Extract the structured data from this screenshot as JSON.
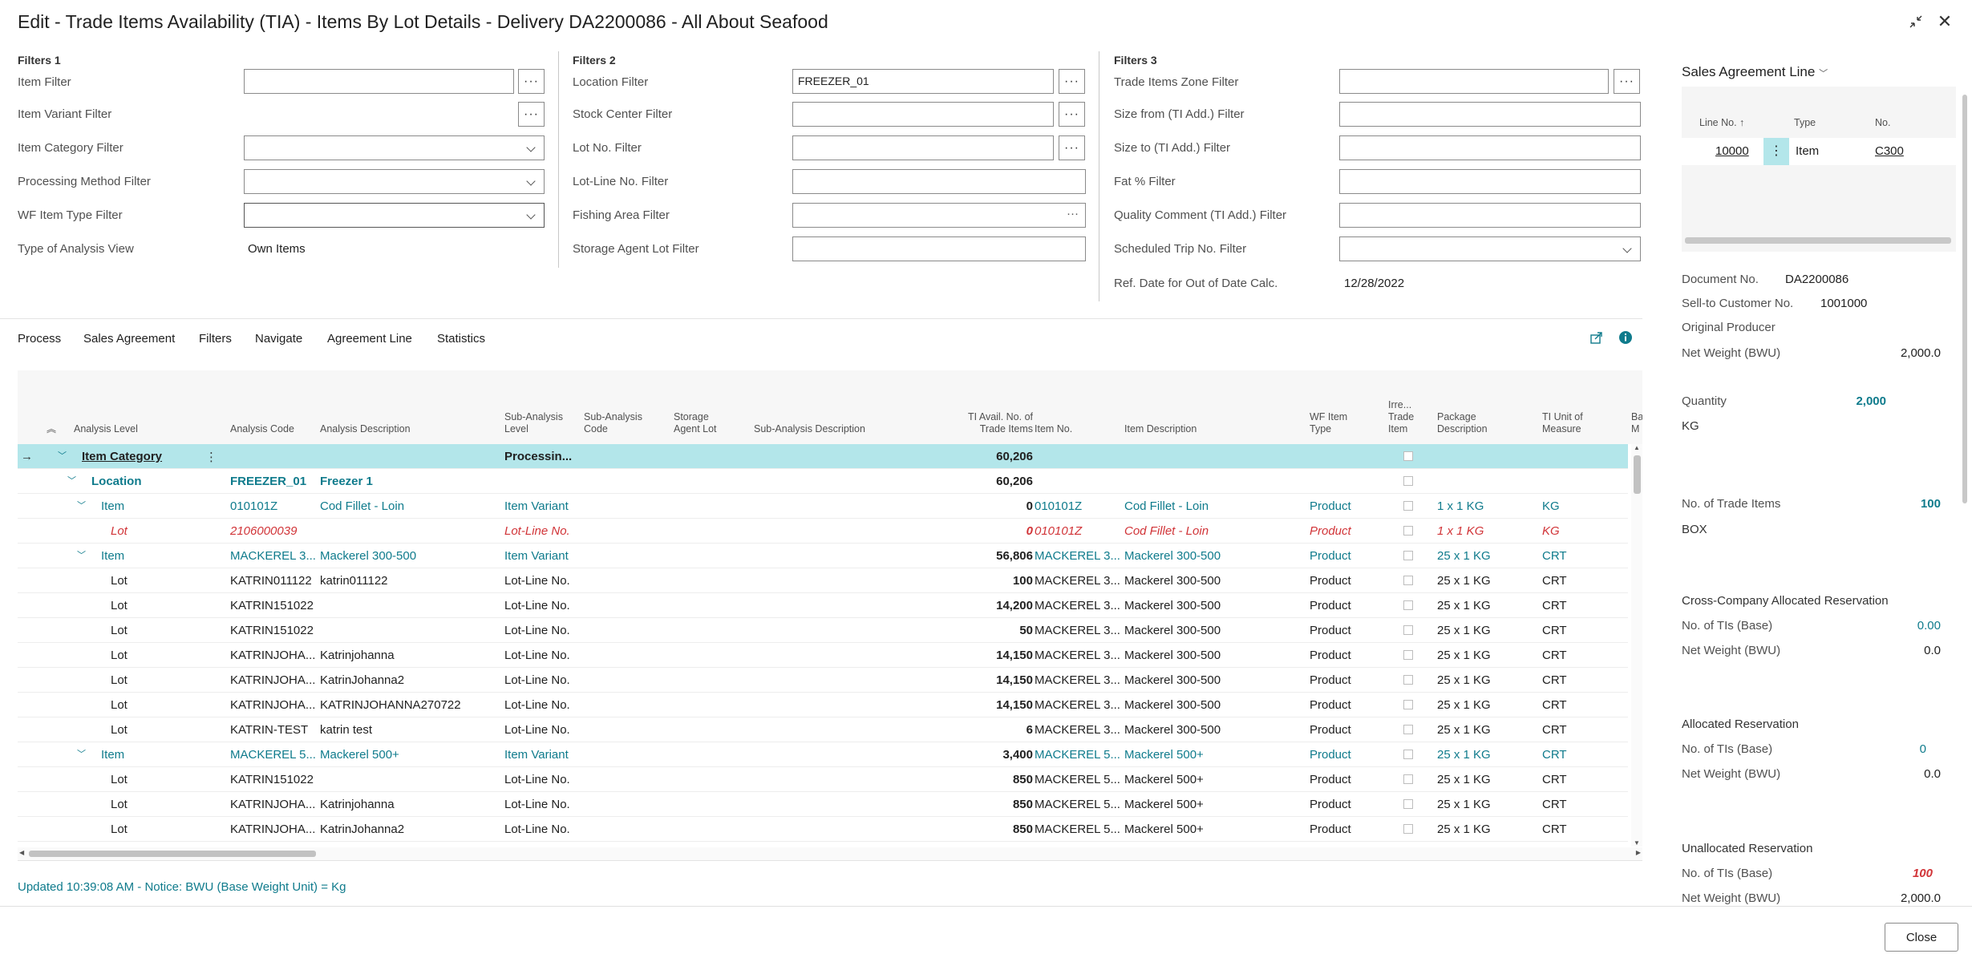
{
  "window": {
    "title": "Edit - Trade Items Availability (TIA) - Items By Lot Details - Delivery DA2200086 - All About Seafood",
    "collapse_icon": "↙↗",
    "close_icon": "✕"
  },
  "filters1": {
    "title": "Filters 1",
    "item_filter": {
      "label": "Item Filter",
      "value": ""
    },
    "item_variant_filter": {
      "label": "Item Variant Filter"
    },
    "item_category_filter": {
      "label": "Item Category Filter",
      "value": ""
    },
    "processing_method_filter": {
      "label": "Processing Method Filter",
      "value": ""
    },
    "wf_item_type_filter": {
      "label": "WF Item Type Filter",
      "value": ""
    },
    "type_of_analysis_view": {
      "label": "Type of Analysis View",
      "value": "Own Items"
    }
  },
  "filters2": {
    "title": "Filters 2",
    "location_filter": {
      "label": "Location Filter",
      "value": "FREEZER_01"
    },
    "stock_center_filter": {
      "label": "Stock Center Filter",
      "value": ""
    },
    "lot_no_filter": {
      "label": "Lot No. Filter",
      "value": ""
    },
    "lot_line_no_filter": {
      "label": "Lot-Line No. Filter",
      "value": ""
    },
    "fishing_area_filter": {
      "label": "Fishing Area Filter",
      "value": ""
    },
    "storage_agent_lot_filter": {
      "label": "Storage Agent Lot Filter",
      "value": ""
    }
  },
  "filters3": {
    "title": "Filters 3",
    "trade_items_zone_filter": {
      "label": "Trade Items Zone Filter",
      "value": ""
    },
    "size_from_filter": {
      "label": "Size from (TI Add.) Filter",
      "value": ""
    },
    "size_to_filter": {
      "label": "Size to (TI Add.) Filter",
      "value": ""
    },
    "fat_filter": {
      "label": "Fat % Filter",
      "value": ""
    },
    "quality_comment_filter": {
      "label": "Quality Comment (TI Add.) Filter",
      "value": ""
    },
    "scheduled_trip_filter": {
      "label": "Scheduled Trip No. Filter",
      "value": ""
    },
    "ref_date": {
      "label": "Ref. Date for Out of Date Calc.",
      "value": "12/28/2022"
    }
  },
  "menu": {
    "items": [
      "Process",
      "Sales Agreement",
      "Filters",
      "Navigate",
      "Agreement Line",
      "Statistics"
    ],
    "share_icon": "share-icon",
    "info_icon": "info-icon"
  },
  "grid": {
    "headers": {
      "analysis_level": "Analysis Level",
      "analysis_code": "Analysis Code",
      "analysis_description": "Analysis Description",
      "sub_analysis_level": [
        "Sub-Analysis",
        "Level"
      ],
      "sub_analysis_code": [
        "Sub-Analysis",
        "Code"
      ],
      "storage_agent_lot": [
        "Storage",
        "Agent Lot"
      ],
      "sub_analysis_description": "Sub-Analysis Description",
      "ti_avail": [
        "TI Avail. No. of",
        "Trade Items"
      ],
      "item_no": "Item No.",
      "item_description": "Item Description",
      "wf_item_type": [
        "WF Item",
        "Type"
      ],
      "irre_trade_item": [
        "Irre...",
        "Trade",
        "Item"
      ],
      "package_description": [
        "Package",
        "Description"
      ],
      "ti_unit_of_measure": [
        "TI Unit of",
        "Measure"
      ],
      "truncated": [
        "Ba",
        "M"
      ]
    },
    "rows": [
      {
        "style": "selected",
        "indent": 0,
        "level": "Item Category",
        "code": "",
        "desc": "",
        "sub_level": "Processin...",
        "avail": "60,206",
        "item_no": "",
        "item_desc": "",
        "wf_type": "",
        "pkg": "",
        "uom": ""
      },
      {
        "style": "location",
        "indent": 1,
        "level": "Location",
        "code": "FREEZER_01",
        "desc": "Freezer 1",
        "sub_level": "",
        "avail": "60,206",
        "item_no": "",
        "item_desc": "",
        "wf_type": "",
        "pkg": "",
        "uom": ""
      },
      {
        "style": "item",
        "indent": 2,
        "level": "Item",
        "code": "010101Z",
        "desc": "Cod Fillet - Loin",
        "sub_level": "Item Variant",
        "avail": "0",
        "item_no": "010101Z",
        "item_desc": "Cod Fillet - Loin",
        "wf_type": "Product",
        "pkg": "1 x 1 KG",
        "uom": "KG"
      },
      {
        "style": "red",
        "indent": 3,
        "level": "Lot",
        "code": "2106000039",
        "desc": "",
        "sub_level": "Lot-Line No.",
        "avail": "0",
        "item_no": "010101Z",
        "item_desc": "Cod Fillet - Loin",
        "wf_type": "Product",
        "pkg": "1 x 1 KG",
        "uom": "KG"
      },
      {
        "style": "item",
        "indent": 2,
        "level": "Item",
        "code": "MACKEREL 3...",
        "desc": "Mackerel 300-500",
        "sub_level": "Item Variant",
        "avail": "56,806",
        "item_no": "MACKEREL 3...",
        "item_desc": "Mackerel 300-500",
        "wf_type": "Product",
        "pkg": "25 x 1 KG",
        "uom": "CRT"
      },
      {
        "style": "lot",
        "indent": 3,
        "level": "Lot",
        "code": "KATRIN011122",
        "desc": "katrin011122",
        "sub_level": "Lot-Line No.",
        "avail": "100",
        "item_no": "MACKEREL 3...",
        "item_desc": "Mackerel 300-500",
        "wf_type": "Product",
        "pkg": "25 x 1 KG",
        "uom": "CRT"
      },
      {
        "style": "lot",
        "indent": 3,
        "level": "Lot",
        "code": "KATRIN151022",
        "desc": "",
        "sub_level": "Lot-Line No.",
        "avail": "14,200",
        "item_no": "MACKEREL 3...",
        "item_desc": "Mackerel 300-500",
        "wf_type": "Product",
        "pkg": "25 x 1 KG",
        "uom": "CRT"
      },
      {
        "style": "lot",
        "indent": 3,
        "level": "Lot",
        "code": "KATRIN151022",
        "desc": "",
        "sub_level": "Lot-Line No.",
        "avail": "50",
        "item_no": "MACKEREL 3...",
        "item_desc": "Mackerel 300-500",
        "wf_type": "Product",
        "pkg": "25 x 1 KG",
        "uom": "CRT"
      },
      {
        "style": "lot",
        "indent": 3,
        "level": "Lot",
        "code": "KATRINJOHA...",
        "desc": "Katrinjohanna",
        "sub_level": "Lot-Line No.",
        "avail": "14,150",
        "item_no": "MACKEREL 3...",
        "item_desc": "Mackerel 300-500",
        "wf_type": "Product",
        "pkg": "25 x 1 KG",
        "uom": "CRT"
      },
      {
        "style": "lot",
        "indent": 3,
        "level": "Lot",
        "code": "KATRINJOHA...",
        "desc": "KatrinJohanna2",
        "sub_level": "Lot-Line No.",
        "avail": "14,150",
        "item_no": "MACKEREL 3...",
        "item_desc": "Mackerel 300-500",
        "wf_type": "Product",
        "pkg": "25 x 1 KG",
        "uom": "CRT"
      },
      {
        "style": "lot",
        "indent": 3,
        "level": "Lot",
        "code": "KATRINJOHA...",
        "desc": "KATRINJOHANNA270722",
        "sub_level": "Lot-Line No.",
        "avail": "14,150",
        "item_no": "MACKEREL 3...",
        "item_desc": "Mackerel 300-500",
        "wf_type": "Product",
        "pkg": "25 x 1 KG",
        "uom": "CRT"
      },
      {
        "style": "lot",
        "indent": 3,
        "level": "Lot",
        "code": "KATRIN-TEST",
        "desc": "katrin test",
        "sub_level": "Lot-Line No.",
        "avail": "6",
        "item_no": "MACKEREL 3...",
        "item_desc": "Mackerel 300-500",
        "wf_type": "Product",
        "pkg": "25 x 1 KG",
        "uom": "CRT"
      },
      {
        "style": "item",
        "indent": 2,
        "level": "Item",
        "code": "MACKEREL 5...",
        "desc": "Mackerel 500+",
        "sub_level": "Item Variant",
        "avail": "3,400",
        "item_no": "MACKEREL 5...",
        "item_desc": "Mackerel 500+",
        "wf_type": "Product",
        "pkg": "25 x 1 KG",
        "uom": "CRT"
      },
      {
        "style": "lot",
        "indent": 3,
        "level": "Lot",
        "code": "KATRIN151022",
        "desc": "",
        "sub_level": "Lot-Line No.",
        "avail": "850",
        "item_no": "MACKEREL 5...",
        "item_desc": "Mackerel 500+",
        "wf_type": "Product",
        "pkg": "25 x 1 KG",
        "uom": "CRT"
      },
      {
        "style": "lot",
        "indent": 3,
        "level": "Lot",
        "code": "KATRINJOHA...",
        "desc": "Katrinjohanna",
        "sub_level": "Lot-Line No.",
        "avail": "850",
        "item_no": "MACKEREL 5...",
        "item_desc": "Mackerel 500+",
        "wf_type": "Product",
        "pkg": "25 x 1 KG",
        "uom": "CRT"
      },
      {
        "style": "lot",
        "indent": 3,
        "level": "Lot",
        "code": "KATRINJOHA...",
        "desc": "KatrinJohanna2",
        "sub_level": "Lot-Line No.",
        "avail": "850",
        "item_no": "MACKEREL 5...",
        "item_desc": "Mackerel 500+",
        "wf_type": "Product",
        "pkg": "25 x 1 KG",
        "uom": "CRT"
      }
    ]
  },
  "status": "Updated 10:39:08 AM - Notice: BWU (Base Weight Unit) = Kg",
  "right_pane": {
    "title": "Sales Agreement Line",
    "line_table": {
      "headers": {
        "line_no": "Line No. ↑",
        "type": "Type",
        "no": "No."
      },
      "row": {
        "line_no": "10000",
        "type": "Item",
        "no": "C300"
      }
    },
    "document_no": {
      "label": "Document No.",
      "value": "DA2200086"
    },
    "sell_to_customer": {
      "label": "Sell-to Customer No.",
      "value": "1001000"
    },
    "original_producer": {
      "label": "Original Producer"
    },
    "net_weight": {
      "label": "Net Weight (BWU)",
      "value": "2,000.0"
    },
    "quantity": {
      "label": "Quantity",
      "value": "2,000",
      "unit": "KG"
    },
    "no_of_trade_items": {
      "label": "No. of Trade Items",
      "value": "100",
      "unit": "BOX"
    },
    "cross_company": {
      "title": "Cross-Company Allocated Reservation",
      "tis_label": "No. of TIs (Base)",
      "tis_value": "0.00",
      "nw_label": "Net Weight (BWU)",
      "nw_value": "0.0"
    },
    "allocated": {
      "title": "Allocated Reservation",
      "tis_label": "No. of TIs (Base)",
      "tis_value": "0",
      "nw_label": "Net Weight (BWU)",
      "nw_value": "0.0"
    },
    "unallocated": {
      "title": "Unallocated Reservation",
      "tis_label": "No. of TIs (Base)",
      "tis_value": "100",
      "nw_label": "Net Weight (BWU)",
      "nw_value": "2,000.0"
    }
  },
  "footer": {
    "close_label": "Close"
  },
  "colors": {
    "teal": "#0f7b8c",
    "red": "#d13438",
    "selected_row": "#b3e6ea",
    "text": "#212121"
  }
}
